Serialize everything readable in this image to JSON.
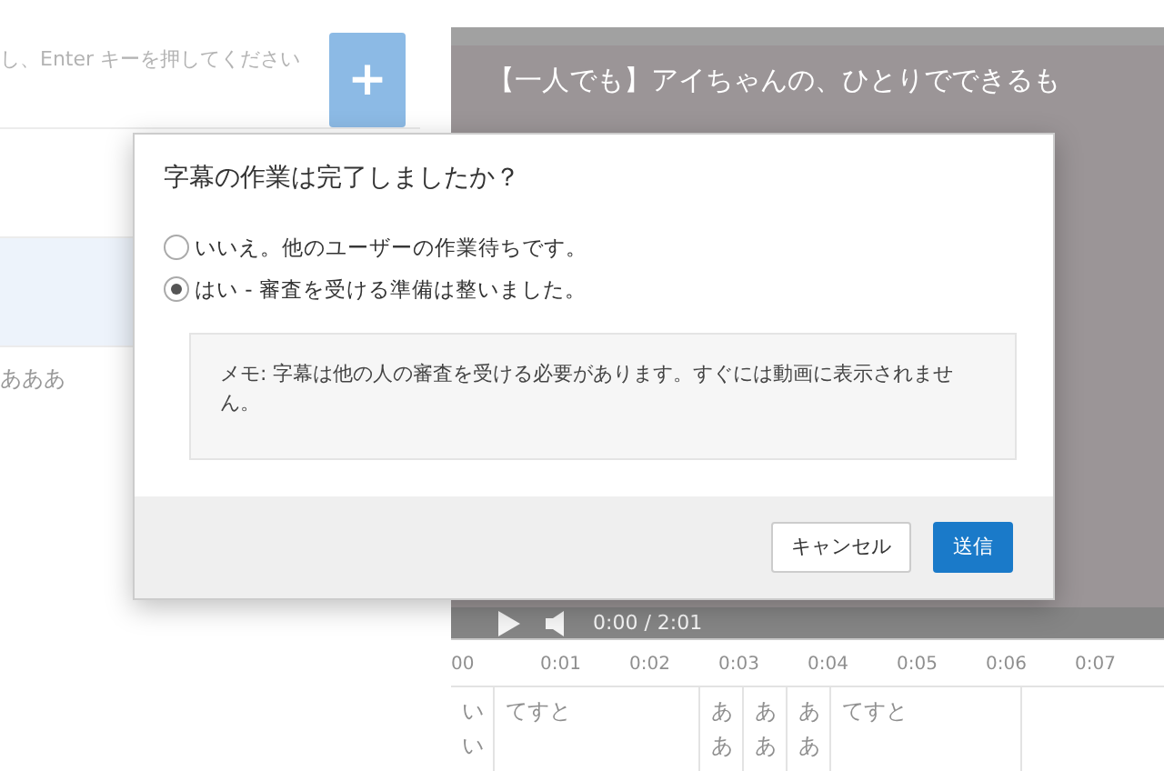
{
  "left_panel": {
    "input": {
      "placeholder": "し、Enter キーを押してください"
    },
    "add_button": "+",
    "list_items": [
      {
        "selected": false
      },
      {
        "selected": true
      },
      {
        "text": "あああ",
        "selected": false
      }
    ]
  },
  "video": {
    "title": "【一人でも】アイちゃんの、ひとりでできるも",
    "time": "0:00 / 2:01"
  },
  "timeline": {
    "ticks": [
      "00",
      "0:01",
      "0:02",
      "0:03",
      "0:04",
      "0:05",
      "0:06",
      "0:07"
    ],
    "subtitles": [
      {
        "text": "いい"
      },
      {
        "text": "てすと"
      },
      {
        "text": "ああ"
      },
      {
        "text": "ああ"
      },
      {
        "text": "ああ"
      },
      {
        "text": "てすと"
      }
    ]
  },
  "dialog": {
    "title": "字幕の作業は完了しましたか？",
    "options": [
      {
        "label": "いいえ。他のユーザーの作業待ちです。",
        "selected": false
      },
      {
        "label": "はい - 審査を受ける準備は整いました。",
        "selected": true
      }
    ],
    "note": "メモ: 字幕は他の人の審査を受ける必要があります。すぐには動画に表示されません。",
    "buttons": [
      {
        "label": "キャンセル",
        "kind": "secondary"
      },
      {
        "label": "送信",
        "kind": "primary"
      }
    ]
  }
}
